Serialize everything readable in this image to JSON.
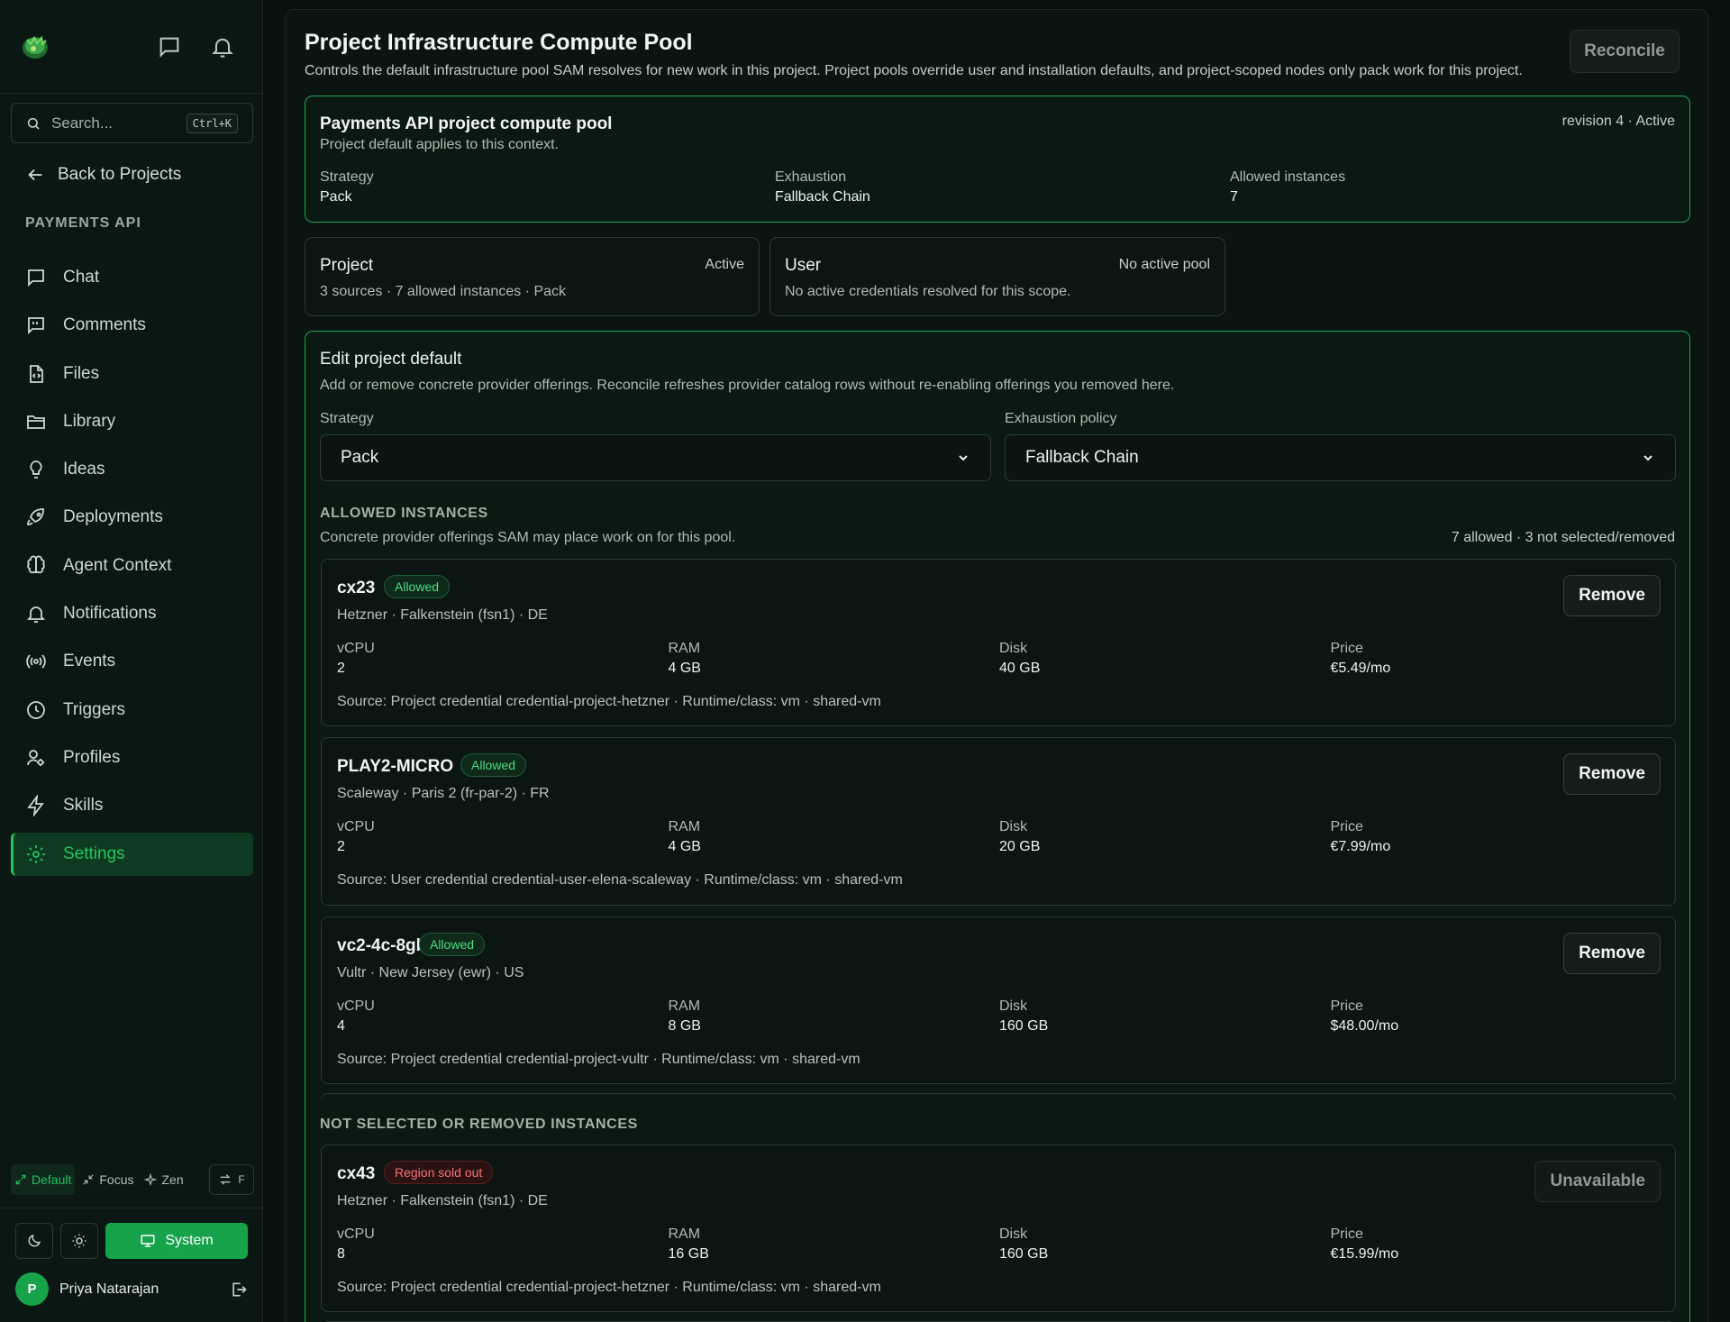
{
  "sidebar": {
    "search": {
      "placeholder": "Search...",
      "shortcut": "Ctrl+K"
    },
    "back_label": "Back to Projects",
    "section_title": "PAYMENTS API",
    "items": [
      {
        "label": "Chat",
        "icon": "chat-icon"
      },
      {
        "label": "Comments",
        "icon": "comments-icon"
      },
      {
        "label": "Files",
        "icon": "file-icon"
      },
      {
        "label": "Library",
        "icon": "folder-icon"
      },
      {
        "label": "Ideas",
        "icon": "lightbulb-icon"
      },
      {
        "label": "Deployments",
        "icon": "rocket-icon"
      },
      {
        "label": "Agent Context",
        "icon": "brain-icon"
      },
      {
        "label": "Notifications",
        "icon": "bell-icon"
      },
      {
        "label": "Events",
        "icon": "broadcast-icon"
      },
      {
        "label": "Triggers",
        "icon": "clock-icon"
      },
      {
        "label": "Profiles",
        "icon": "user-gear-icon"
      },
      {
        "label": "Skills",
        "icon": "bolt-icon"
      },
      {
        "label": "Settings",
        "icon": "gear-icon",
        "active": true
      }
    ],
    "modes": {
      "default": "Default",
      "focus": "Focus",
      "zen": "Zen",
      "toggle": "F"
    },
    "theme": {
      "system_label": "System"
    },
    "user": {
      "initial": "P",
      "name": "Priya Natarajan"
    }
  },
  "main": {
    "title": "Project Infrastructure Compute Pool",
    "subtitle": "Controls the default infrastructure pool SAM resolves for new work in this project. Project pools override user and installation defaults, and project-scoped nodes only pack work for this project.",
    "reconcile_label": "Reconcile",
    "summary": {
      "name": "Payments API project compute pool",
      "meta": "revision 4 · Active",
      "note": "Project default applies to this context.",
      "fields": [
        {
          "label": "Strategy",
          "value": "Pack"
        },
        {
          "label": "Exhaustion",
          "value": "Fallback Chain"
        },
        {
          "label": "Allowed instances",
          "value": "7"
        }
      ]
    },
    "scopes": [
      {
        "title": "Project",
        "status": "Active",
        "desc": "3 sources · 7 allowed instances · Pack"
      },
      {
        "title": "User",
        "status": "No active pool",
        "desc": "No active credentials resolved for this scope."
      }
    ],
    "edit": {
      "title": "Edit project default",
      "desc": "Add or remove concrete provider offerings. Reconcile refreshes provider catalog rows without re-enabling offerings you removed here.",
      "strategy_label": "Strategy",
      "strategy_value": "Pack",
      "exhaustion_label": "Exhaustion policy",
      "exhaustion_value": "Fallback Chain",
      "allowed_heading": "ALLOWED INSTANCES",
      "allowed_desc": "Concrete provider offerings SAM may place work on for this pool.",
      "allowed_count": "7 allowed · 3 not selected/removed",
      "spec_labels": {
        "vcpu": "vCPU",
        "ram": "RAM",
        "disk": "Disk",
        "price": "Price"
      },
      "allowed": [
        {
          "name": "cx23",
          "badge": "Allowed",
          "location": "Hetzner · Falkenstein (fsn1) · DE",
          "vcpu": "2",
          "ram": "4 GB",
          "disk": "40 GB",
          "price": "€5.49/mo",
          "source": "Source: Project credential credential-project-hetzner · Runtime/class: vm · shared-vm",
          "action": "Remove"
        },
        {
          "name": "PLAY2-MICRO",
          "badge": "Allowed",
          "location": "Scaleway · Paris 2 (fr-par-2) · FR",
          "vcpu": "2",
          "ram": "4 GB",
          "disk": "20 GB",
          "price": "€7.99/mo",
          "source": "Source: User credential credential-user-elena-scaleway · Runtime/class: vm · shared-vm",
          "action": "Remove"
        },
        {
          "name": "vc2-4c-8gb",
          "badge": "Allowed",
          "location": "Vultr · New Jersey (ewr) · US",
          "vcpu": "4",
          "ram": "8 GB",
          "disk": "160 GB",
          "price": "$48.00/mo",
          "source": "Source: Project credential credential-project-vultr · Runtime/class: vm · shared-vm",
          "action": "Remove"
        }
      ],
      "removed_heading": "NOT SELECTED OR REMOVED INSTANCES",
      "removed": [
        {
          "name": "cx43",
          "badge": "Region sold out",
          "location": "Hetzner · Falkenstein (fsn1) · DE",
          "vcpu": "8",
          "ram": "16 GB",
          "disk": "160 GB",
          "price": "€15.99/mo",
          "source": "Source: Project credential credential-project-hetzner · Runtime/class: vm · shared-vm",
          "action": "Unavailable"
        }
      ]
    }
  },
  "colors": {
    "accent": "#22c55e",
    "accent_dark": "#16a34a",
    "danger": "#f87171",
    "background": "#08110d"
  }
}
